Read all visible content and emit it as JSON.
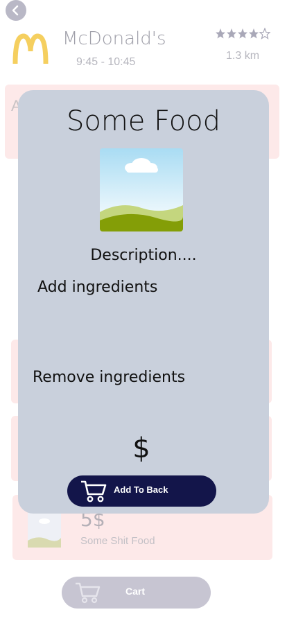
{
  "header": {
    "restaurant_name": "McDonald's",
    "hours": "9:45 - 10:45",
    "rating_stars": 4,
    "rating_max": 5,
    "distance": "1.3 km"
  },
  "background": {
    "card_letter": "A",
    "food_item": {
      "price": "5$",
      "name": "Some Shit Food"
    },
    "cart_button_label": "Cart"
  },
  "modal": {
    "title": "Some Food",
    "description": "Description....",
    "add_ingredients_label": "Add ingredients",
    "remove_ingredients_label": "Remove ingredients",
    "price": "$",
    "add_button_label": "Add To Back"
  },
  "colors": {
    "modal_bg": "#c9d0dc",
    "primary_button": "#13154a",
    "card_bg": "#fde9e9",
    "logo_yellow": "#f5cf5f"
  },
  "icons": [
    "back-icon",
    "mcdonalds-logo",
    "star-icon",
    "cart-icon",
    "image-placeholder-icon"
  ]
}
